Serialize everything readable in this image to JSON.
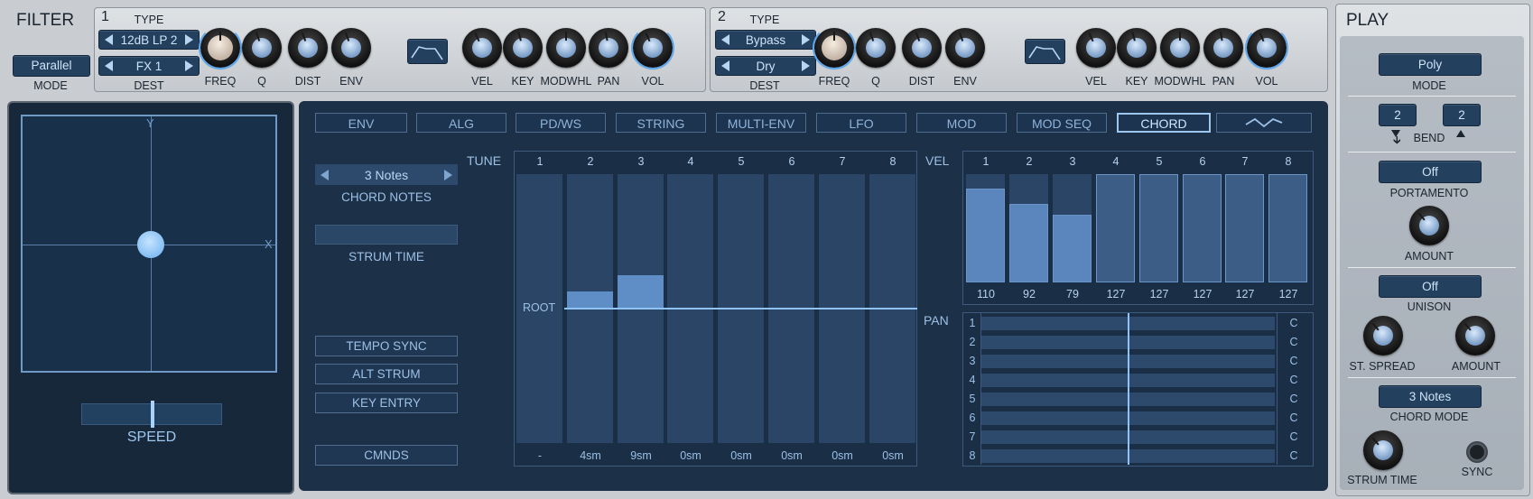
{
  "filter": {
    "title": "FILTER",
    "mode_value": "Parallel",
    "mode_label": "MODE",
    "f1": {
      "num": "1",
      "type_label": "TYPE",
      "type_value": "12dB LP 2",
      "dest_value": "FX 1",
      "dest_label": "DEST",
      "knobs": [
        "FREQ",
        "Q",
        "DIST",
        "ENV",
        "VEL",
        "KEY",
        "MODWHL",
        "PAN",
        "VOL"
      ]
    },
    "f2": {
      "num": "2",
      "type_label": "TYPE",
      "type_value": "Bypass",
      "dest_value": "Dry",
      "dest_label": "DEST",
      "knobs": [
        "FREQ",
        "Q",
        "DIST",
        "ENV",
        "VEL",
        "KEY",
        "MODWHL",
        "PAN",
        "VOL"
      ]
    }
  },
  "xy": {
    "y_label": "Y",
    "x_label": "X",
    "speed_label": "SPEED"
  },
  "tabs": [
    "ENV",
    "ALG",
    "PD/WS",
    "STRING",
    "MULTI-ENV",
    "LFO",
    "MOD",
    "MOD SEQ",
    "CHORD"
  ],
  "active_tab": "CHORD",
  "chord": {
    "notes_value": "3 Notes",
    "notes_label": "CHORD NOTES",
    "strum_label": "STRUM TIME",
    "tempo_sync": "TEMPO SYNC",
    "alt_strum": "ALT STRUM",
    "key_entry": "KEY ENTRY",
    "cmnds": "CMNDS"
  },
  "tune": {
    "label": "TUNE",
    "root_label": "ROOT",
    "columns": [
      "1",
      "2",
      "3",
      "4",
      "5",
      "6",
      "7",
      "8"
    ],
    "offsets": [
      0,
      1,
      2,
      0,
      0,
      0,
      0,
      0
    ],
    "strum_values": [
      "-",
      "4sm",
      "9sm",
      "0sm",
      "0sm",
      "0sm",
      "0sm",
      "0sm"
    ]
  },
  "vel": {
    "label": "VEL",
    "columns": [
      "1",
      "2",
      "3",
      "4",
      "5",
      "6",
      "7",
      "8"
    ],
    "values": [
      "110",
      "92",
      "79",
      "127",
      "127",
      "127",
      "127",
      "127"
    ],
    "max": 127
  },
  "pan": {
    "label": "PAN",
    "rows": [
      "1",
      "2",
      "3",
      "4",
      "5",
      "6",
      "7",
      "8"
    ],
    "values": [
      "C",
      "C",
      "C",
      "C",
      "C",
      "C",
      "C",
      "C"
    ]
  },
  "play": {
    "title": "PLAY",
    "mode_value": "Poly",
    "mode_label": "MODE",
    "bend_down": "2",
    "bend_up": "2",
    "bend_label": "BEND",
    "portamento_value": "Off",
    "portamento_label": "PORTAMENTO",
    "amount_label": "AMOUNT",
    "unison_value": "Off",
    "unison_label": "UNISON",
    "st_spread_label": "ST. SPREAD",
    "amount2_label": "AMOUNT",
    "chord_mode_value": "3 Notes",
    "chord_mode_label": "CHORD MODE",
    "strum_time_label": "STRUM TIME",
    "sync_label": "SYNC"
  }
}
